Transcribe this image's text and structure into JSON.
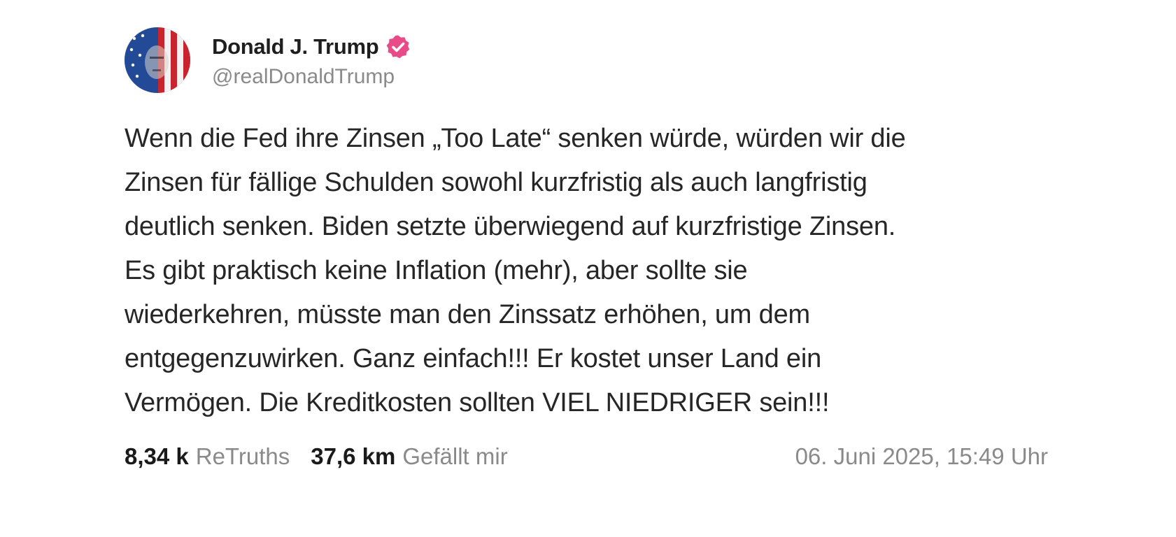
{
  "author": {
    "display_name": "Donald J. Trump",
    "handle": "@realDonaldTrump",
    "verified": true,
    "verified_color": "#e84c88"
  },
  "post": {
    "lines": [
      "Wenn die Fed ihre Zinsen „Too Late“ senken würde, würden wir die",
      "Zinsen für fällige Schulden sowohl kurzfristig als auch langfristig",
      "deutlich senken. Biden setzte überwiegend auf kurzfristige Zinsen.",
      "Es gibt praktisch keine Inflation (mehr), aber sollte sie",
      "wiederkehren, müsste man den Zinssatz erhöhen, um dem",
      "entgegenzuwirken. Ganz einfach!!! Er kostet unser Land ein",
      "Vermögen. Die Kreditkosten sollten VIEL NIEDRIGER sein!!!"
    ]
  },
  "stats": {
    "retruths_count": "8,34 k",
    "retruths_label": "ReTruths",
    "likes_count": "37,6 km",
    "likes_label": "Gefällt mir"
  },
  "timestamp": "06. Juni 2025, 15:49 Uhr",
  "icons": {
    "avatar": "flag-portrait-avatar",
    "verified": "verified-badge-icon"
  }
}
